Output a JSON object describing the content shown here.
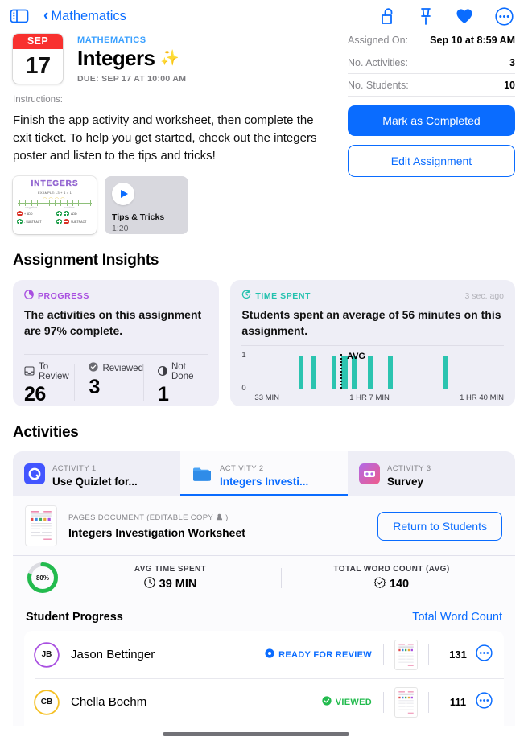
{
  "navbar": {
    "sidebar_toggle": "sidebar-toggle",
    "back_label": "Mathematics",
    "icons": [
      "unlock-icon",
      "pin-icon",
      "heart-icon",
      "more-circle-icon"
    ]
  },
  "header": {
    "calendar_month": "SEP",
    "calendar_day": "17",
    "subject": "MATHEMATICS",
    "title": "Integers",
    "sparkle": "✨",
    "due": "DUE: SEP 17 AT 10:00 AM"
  },
  "info": {
    "rows": [
      {
        "key": "Assigned On:",
        "value": "Sep 10 at 8:59 AM"
      },
      {
        "key": "No. Activities:",
        "value": "3"
      },
      {
        "key": "No. Students:",
        "value": "10"
      }
    ],
    "primary_button": "Mark as Completed",
    "secondary_button": "Edit Assignment"
  },
  "instructions": {
    "label": "Instructions:",
    "text": "Finish the app activity and worksheet, then complete the exit ticket. To help you get started, check out the integers poster and listen to the tips and tricks!",
    "poster": {
      "title": "INTEGERS",
      "subtitle": "EXAMPLE: -3 + 4 = 1",
      "left_word": "negative",
      "right_word": "positive",
      "legend": [
        "+ ADD",
        "- SUBTRACT",
        "ADD",
        "SUBTRACT"
      ]
    },
    "video": {
      "title": "Tips & Tricks",
      "duration": "1:20"
    }
  },
  "insights": {
    "section_title": "Assignment Insights",
    "progress": {
      "tag": "PROGRESS",
      "body": "The activities on this assignment are 97% complete.",
      "stats": [
        {
          "icon": "tray-icon",
          "label": "To Review",
          "value": "26"
        },
        {
          "icon": "check-circle-icon",
          "label": "Reviewed",
          "value": "3"
        },
        {
          "icon": "half-circle-icon",
          "label": "Not Done",
          "value": "1"
        }
      ]
    },
    "time_spent": {
      "tag": "TIME SPENT",
      "ago": "3 sec. ago",
      "body": "Students spent an average of 56 minutes on this assignment.",
      "avg_label": "AVG"
    }
  },
  "chart_data": {
    "type": "bar",
    "title": "Time Spent",
    "xlabel": "",
    "ylabel": "",
    "ylim": [
      0,
      1
    ],
    "ytick_labels": [
      "0",
      "1"
    ],
    "x_tick_labels": [
      "33 MIN",
      "1 HR 7 MIN",
      "1 HR 40 MIN"
    ],
    "x_tick_positions_pct": [
      0,
      50,
      100
    ],
    "axis_min_minutes": 33,
    "axis_max_minutes": 100,
    "average_minutes": 56,
    "average_marker_pct": 34.5,
    "bar_positions_pct": [
      17.5,
      22.5,
      31.0,
      35.5,
      34.8,
      39.0,
      45.5,
      53.5,
      75.5
    ],
    "values": [
      1,
      1,
      1,
      1,
      1,
      1,
      1,
      1,
      1
    ],
    "bar_color": "#2bc4b0",
    "grid": false,
    "legend": "none"
  },
  "activities": {
    "section_title": "Activities",
    "tabs": [
      {
        "kicker": "ACTIVITY 1",
        "name": "Use Quizlet for...",
        "icon": "quizlet-icon",
        "active": false
      },
      {
        "kicker": "ACTIVITY 2",
        "name": "Integers Investi...",
        "icon": "folder-icon",
        "active": true
      },
      {
        "kicker": "ACTIVITY 3",
        "name": "Survey",
        "icon": "survey-icon",
        "active": false
      }
    ],
    "document": {
      "kicker": "PAGES DOCUMENT (EDITABLE COPY",
      "kicker_suffix": ")",
      "title": "Integers Investigation Worksheet",
      "return_button": "Return to Students"
    },
    "metrics": {
      "ring_pct": "80%",
      "ring_value": 80,
      "items": [
        {
          "label": "AVG TIME SPENT",
          "value": "39 MIN",
          "icon": "clock-icon"
        },
        {
          "label": "TOTAL WORD COUNT (AVG)",
          "value": "140",
          "icon": "check-seal-icon"
        }
      ]
    },
    "student_progress": {
      "title": "Student Progress",
      "link": "Total Word Count",
      "rows": [
        {
          "initials": "JB",
          "ring_color": "#a84ee0",
          "name": "Jason Bettinger",
          "status": "READY FOR REVIEW",
          "status_type": "review",
          "count": "131"
        },
        {
          "initials": "CB",
          "ring_color": "#f5c024",
          "name": "Chella Boehm",
          "status": "VIEWED",
          "status_type": "viewed",
          "count": "111"
        }
      ]
    }
  },
  "colors": {
    "accent_blue": "#0a6cff",
    "purple": "#a84ee0",
    "teal": "#2bc4b0",
    "green": "#23bb4e",
    "red": "#f8312f",
    "card_bg": "#eeeef6"
  }
}
